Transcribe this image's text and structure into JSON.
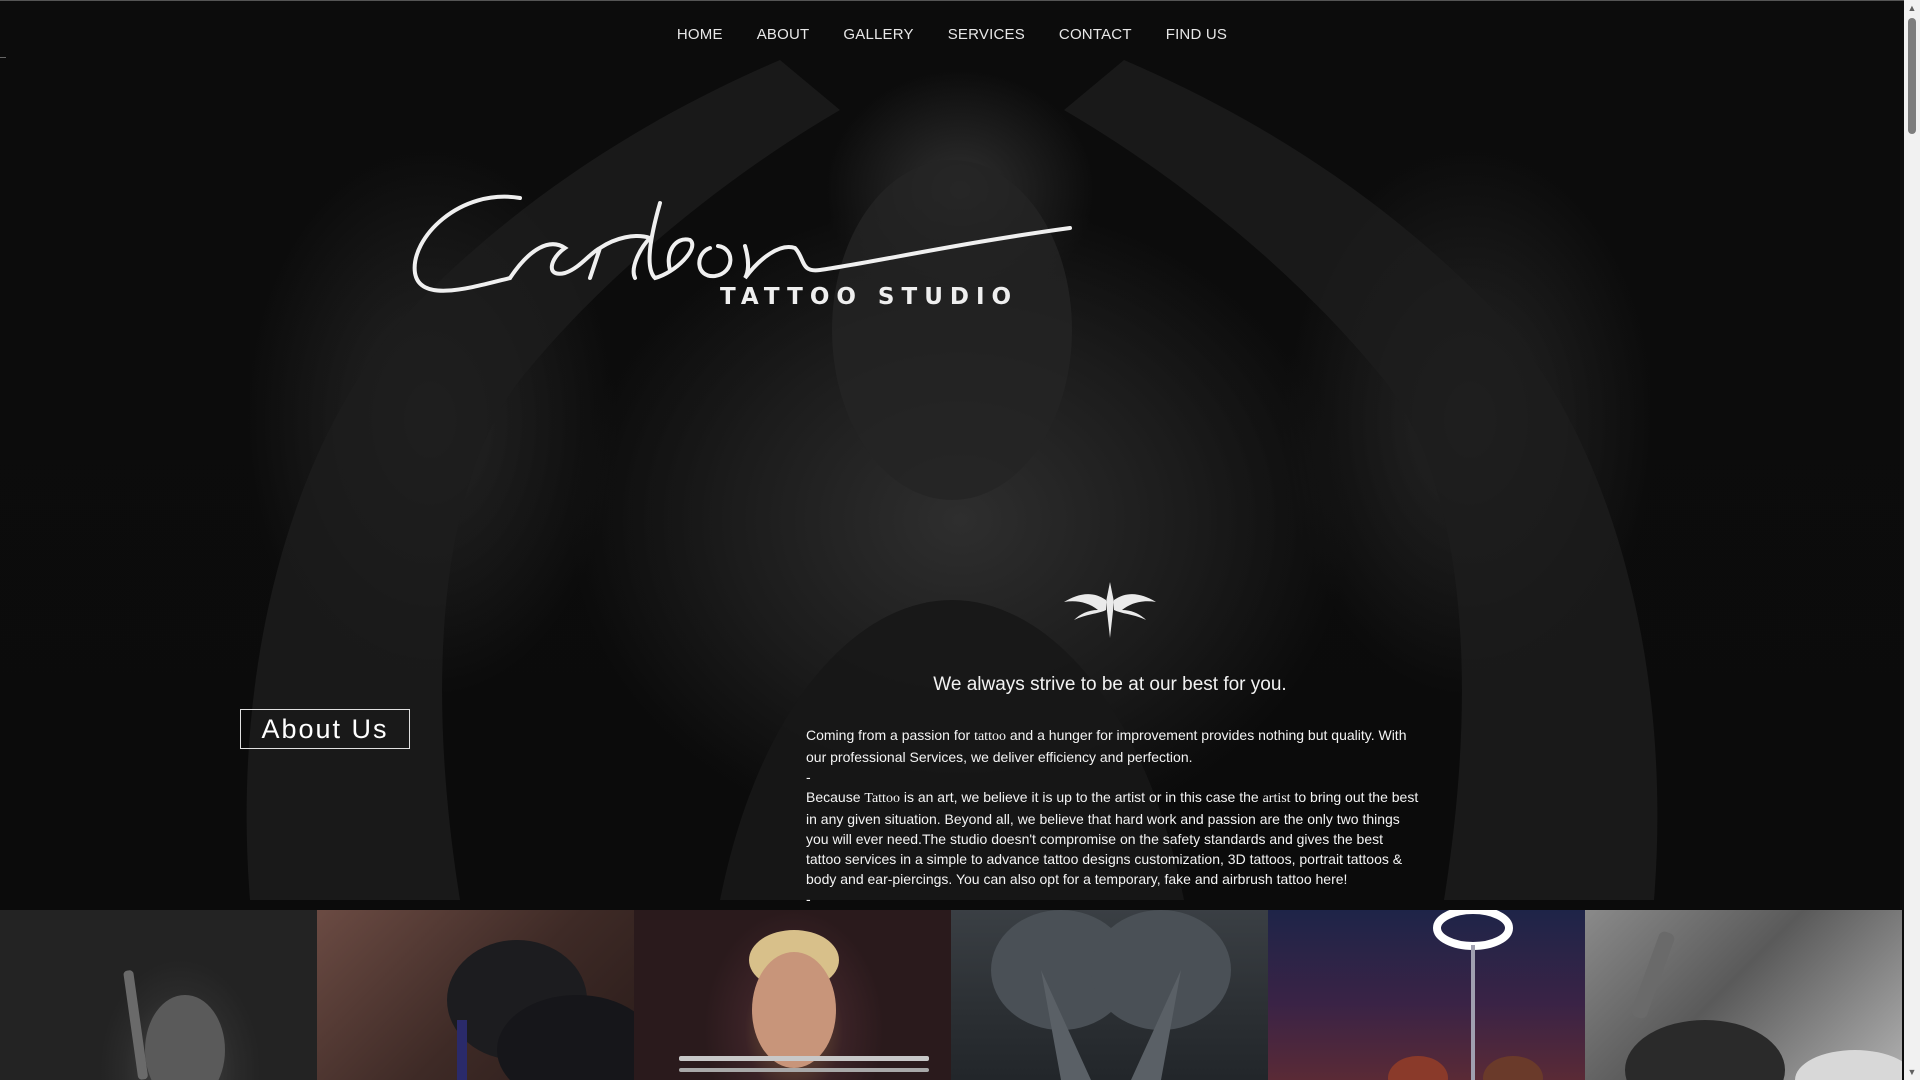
{
  "nav": {
    "items": [
      {
        "label": "HOME"
      },
      {
        "label": "ABOUT"
      },
      {
        "label": "GALLERY"
      },
      {
        "label": "SERVICES"
      },
      {
        "label": "CONTACT"
      },
      {
        "label": "FIND US"
      }
    ]
  },
  "hero": {
    "logo_script": "Carbon",
    "logo_subtitle": "TATTOO STUDIO",
    "emblem_icon": "tribal-emblem-icon"
  },
  "about": {
    "heading": "About Us",
    "tagline": "We always strive to be at our best for you.",
    "p1_before": "Coming from a passion for ",
    "p1_word": "tattoo",
    "p1_after": " and a hunger for improvement provides nothing but quality. With our professional Services, we deliver efficiency and perfection.",
    "sep1": "-",
    "p2_before": "Because ",
    "p2_word1": "Tattoo",
    "p2_mid": " is an art, we believe it is up to the artist or in this case the ",
    "p2_word2": "artist",
    "p2_after": " to bring out the best in any given situation. Beyond all, we believe that hard work and passion are the only two things you will ever need.The studio doesn't compromise on the safety standards and gives the best tattoo services in a simple to advance tattoo designs customization, 3D tattoos, portrait tattoos & body and ear-piercings. You can also opt for a temporary, fake and airbrush tattoo here!",
    "sep2": "-"
  },
  "gallery": {
    "tiles": [
      {
        "name": "artist-with-machine"
      },
      {
        "name": "gloved-hands-tattooing"
      },
      {
        "name": "blond-man-portrait"
      },
      {
        "name": "tattooed-arms"
      },
      {
        "name": "studio-ring-light"
      },
      {
        "name": "machine-close-up"
      }
    ]
  },
  "colors": {
    "background": "#0a0a0a",
    "text": "#ffffff",
    "scrollbar_thumb": "#7d7d7d"
  }
}
